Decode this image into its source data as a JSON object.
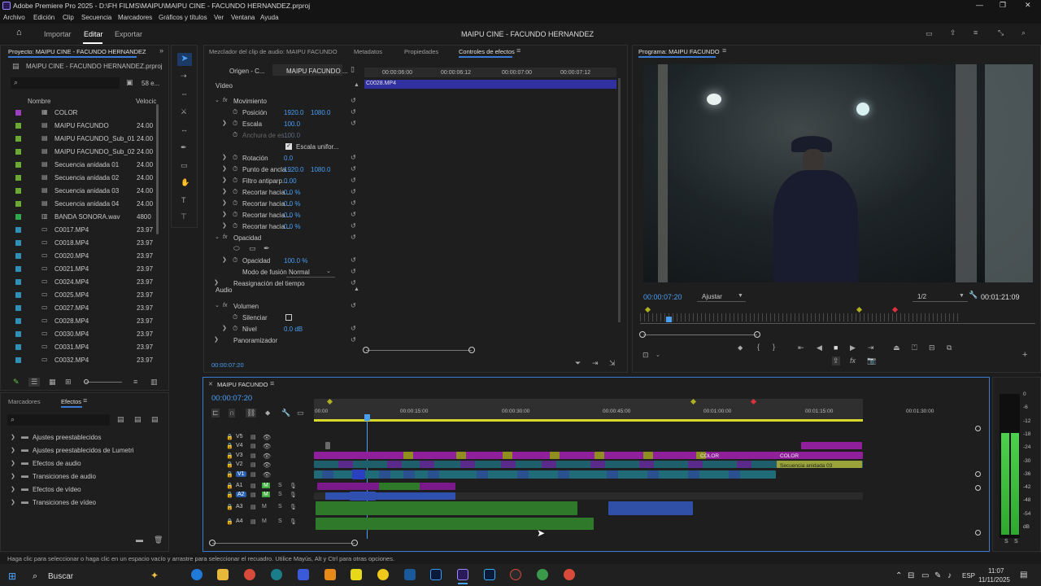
{
  "window": {
    "title": "Adobe Premiere Pro 2025 - D:\\FH FILMS\\MAIPU\\MAIPU CINE - FACUNDO HERNANDEZ.prproj"
  },
  "menu": [
    "Archivo",
    "Edición",
    "Clip",
    "Secuencia",
    "Marcadores",
    "Gráficos y títulos",
    "Ver",
    "Ventana",
    "Ayuda"
  ],
  "header": {
    "tabs": [
      "Importar",
      "Editar",
      "Exportar"
    ],
    "active_tab": "Editar",
    "project_title": "MAIPU CINE - FACUNDO HERNANDEZ"
  },
  "project_panel": {
    "tab_label": "Proyecto: MAIPU CINE - FACUNDO HERNANDEZ",
    "file_name": "MAIPU CINE - FACUNDO HERNANDEZ.prproj",
    "item_count": "58 e...",
    "col_name": "Nombre",
    "col_speed": "Velocic",
    "items": [
      {
        "name": "COLOR",
        "fps": "",
        "color": "#9b3fbf"
      },
      {
        "name": "MAIPU FACUNDO",
        "fps": "24.00",
        "color": "#6da832"
      },
      {
        "name": "MAIPU FACUNDO_Sub_01",
        "fps": "24.00",
        "color": "#6da832"
      },
      {
        "name": "MAIPU FACUNDO_Sub_02",
        "fps": "24.00",
        "color": "#6da832"
      },
      {
        "name": "Secuencia anidada 01",
        "fps": "24.00",
        "color": "#6da832"
      },
      {
        "name": "Secuencia anidada 02",
        "fps": "24.00",
        "color": "#6da832"
      },
      {
        "name": "Secuencia anidada 03",
        "fps": "24.00",
        "color": "#6da832"
      },
      {
        "name": "Secuencia anidada 04",
        "fps": "24.00",
        "color": "#6da832"
      },
      {
        "name": "BANDA SONORA.wav",
        "fps": "4800",
        "color": "#2fa84f"
      },
      {
        "name": "C0017.MP4",
        "fps": "23.97",
        "color": "#2f8fb5"
      },
      {
        "name": "C0018.MP4",
        "fps": "23.97",
        "color": "#2f8fb5"
      },
      {
        "name": "C0020.MP4",
        "fps": "23.97",
        "color": "#2f8fb5"
      },
      {
        "name": "C0021.MP4",
        "fps": "23.97",
        "color": "#2f8fb5"
      },
      {
        "name": "C0024.MP4",
        "fps": "23.97",
        "color": "#2f8fb5"
      },
      {
        "name": "C0025.MP4",
        "fps": "23.97",
        "color": "#2f8fb5"
      },
      {
        "name": "C0027.MP4",
        "fps": "23.97",
        "color": "#2f8fb5"
      },
      {
        "name": "C0028.MP4",
        "fps": "23.97",
        "color": "#2f8fb5"
      },
      {
        "name": "C0030.MP4",
        "fps": "23.97",
        "color": "#2f8fb5"
      },
      {
        "name": "C0031.MP4",
        "fps": "23.97",
        "color": "#2f8fb5"
      },
      {
        "name": "C0032.MP4",
        "fps": "23.97",
        "color": "#2f8fb5"
      }
    ]
  },
  "effects_panel": {
    "tabs": [
      "Marcadores",
      "Efectos"
    ],
    "folders": [
      "Ajustes preestablecidos",
      "Ajustes preestablecidos de Lumetri",
      "Efectos de audio",
      "Transiciones de audio",
      "Efectos de vídeo",
      "Transiciones de vídeo"
    ]
  },
  "effect_controls": {
    "tabs": [
      "Mezclador del clip de audio: MAIPU FACUNDO",
      "Metadatos",
      "Propiedades",
      "Controles de efectos"
    ],
    "source_label": "Origen - C...",
    "seq_label": "MAIPU FACUNDO ...",
    "ruler": [
      "00:00:06:00",
      "00:00:06:12",
      "00:00:07:00",
      "00:00:07:12"
    ],
    "clip_name": "C0028.MP4",
    "video_header": "Vídeo",
    "audio_header": "Audio",
    "rows": [
      {
        "label": "Movimiento",
        "v1": "",
        "v2": ""
      },
      {
        "label": "Posición",
        "v1": "1920.0",
        "v2": "1080.0"
      },
      {
        "label": "Escala",
        "v1": "100.0",
        "v2": ""
      },
      {
        "label": "Anchura de es...",
        "v1": "100.0",
        "v2": ""
      },
      {
        "label": "Escala unifor...",
        "v1": "",
        "v2": ""
      },
      {
        "label": "Rotación",
        "v1": "0.0",
        "v2": ""
      },
      {
        "label": "Punto de ancla...",
        "v1": "1920.0",
        "v2": "1080.0"
      },
      {
        "label": "Filtro antiparp...",
        "v1": "0.00",
        "v2": ""
      },
      {
        "label": "Recortar hacia ...",
        "v1": "0.0 %",
        "v2": ""
      },
      {
        "label": "Recortar hacia ...",
        "v1": "0.0 %",
        "v2": ""
      },
      {
        "label": "Recortar hacia ...",
        "v1": "0.0 %",
        "v2": ""
      },
      {
        "label": "Recortar hacia ...",
        "v1": "0.0 %",
        "v2": ""
      },
      {
        "label": "Opacidad",
        "v1": "",
        "v2": ""
      },
      {
        "label": "Opacidad",
        "v1": "100.0 %",
        "v2": ""
      },
      {
        "label": "Modo de fusión",
        "v1": "Normal",
        "v2": ""
      },
      {
        "label": "Reasignación del tiempo",
        "v1": "",
        "v2": ""
      },
      {
        "label": "Volumen",
        "v1": "",
        "v2": ""
      },
      {
        "label": "Silenciar",
        "v1": "",
        "v2": ""
      },
      {
        "label": "Nivel",
        "v1": "0.0 dB",
        "v2": ""
      },
      {
        "label": "Panoramizador",
        "v1": "",
        "v2": ""
      }
    ],
    "timecode": "00:00:07:20"
  },
  "program_monitor": {
    "tab_label": "Programa: MAIPU FACUNDO",
    "timecode": "00:00:07:20",
    "fit_label": "Ajustar",
    "resolution": "1/2",
    "duration": "00:01:21:09"
  },
  "timeline": {
    "tab_label": "MAIPU FACUNDO",
    "timecode": "00:00:07:20",
    "ruler": [
      "00:00",
      "00:00:15:00",
      "00:00:30:00",
      "00:00:45:00",
      "00:01:00:00",
      "00:01:15:00",
      "00:01:30:00"
    ],
    "video_tracks": [
      "V5",
      "V4",
      "V3",
      "V2",
      "V1"
    ],
    "audio_tracks": [
      "A1",
      "A2",
      "A3",
      "A4"
    ],
    "clip_labels": {
      "color1": "COLOR",
      "color2": "COLOR",
      "nested": "Secuencia anidada 03"
    },
    "meter_labels": [
      "0",
      "-6",
      "-12",
      "-18",
      "-24",
      "-30",
      "-36",
      "-42",
      "-48",
      "-54",
      "dB"
    ],
    "meter_solo": [
      "S",
      "S"
    ]
  },
  "status_bar": {
    "text": "Haga clic para seleccionar o haga clic en un espacio vacío y arrastre para seleccionar el recuadro. Utilice Mayús, Alt y Ctrl para otras opciones."
  },
  "taskbar": {
    "search": "Buscar",
    "lang": "ESP",
    "time": "11:07",
    "date": "11/11/2025"
  },
  "colors": {
    "accent": "#3a7bd5",
    "timecode_blue": "#4a9ff5",
    "video_clip_purple": "#8f1f9a",
    "video_clip_teal": "#1f6b78",
    "audio_green": "#2f7a2a",
    "audio_blue": "#3050a8"
  }
}
